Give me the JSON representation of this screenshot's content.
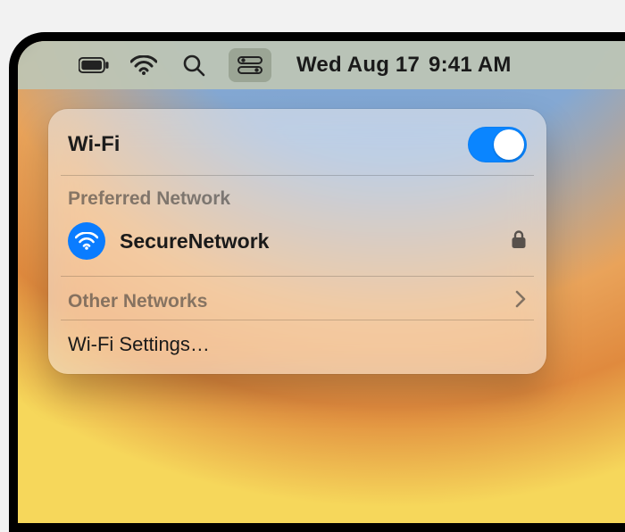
{
  "menubar": {
    "battery_icon": "battery-full",
    "wifi_icon": "wifi",
    "search_icon": "search",
    "control_center_icon": "control-center",
    "date": "Wed Aug 17",
    "time": "9:41 AM"
  },
  "popover": {
    "title": "Wi-Fi",
    "toggle_on": true,
    "preferred_label": "Preferred Network",
    "preferred_network": {
      "name": "SecureNetwork",
      "secured": true
    },
    "other_networks_label": "Other Networks",
    "settings_label": "Wi-Fi Settings…"
  },
  "colors": {
    "accent": "#0a85ff"
  }
}
